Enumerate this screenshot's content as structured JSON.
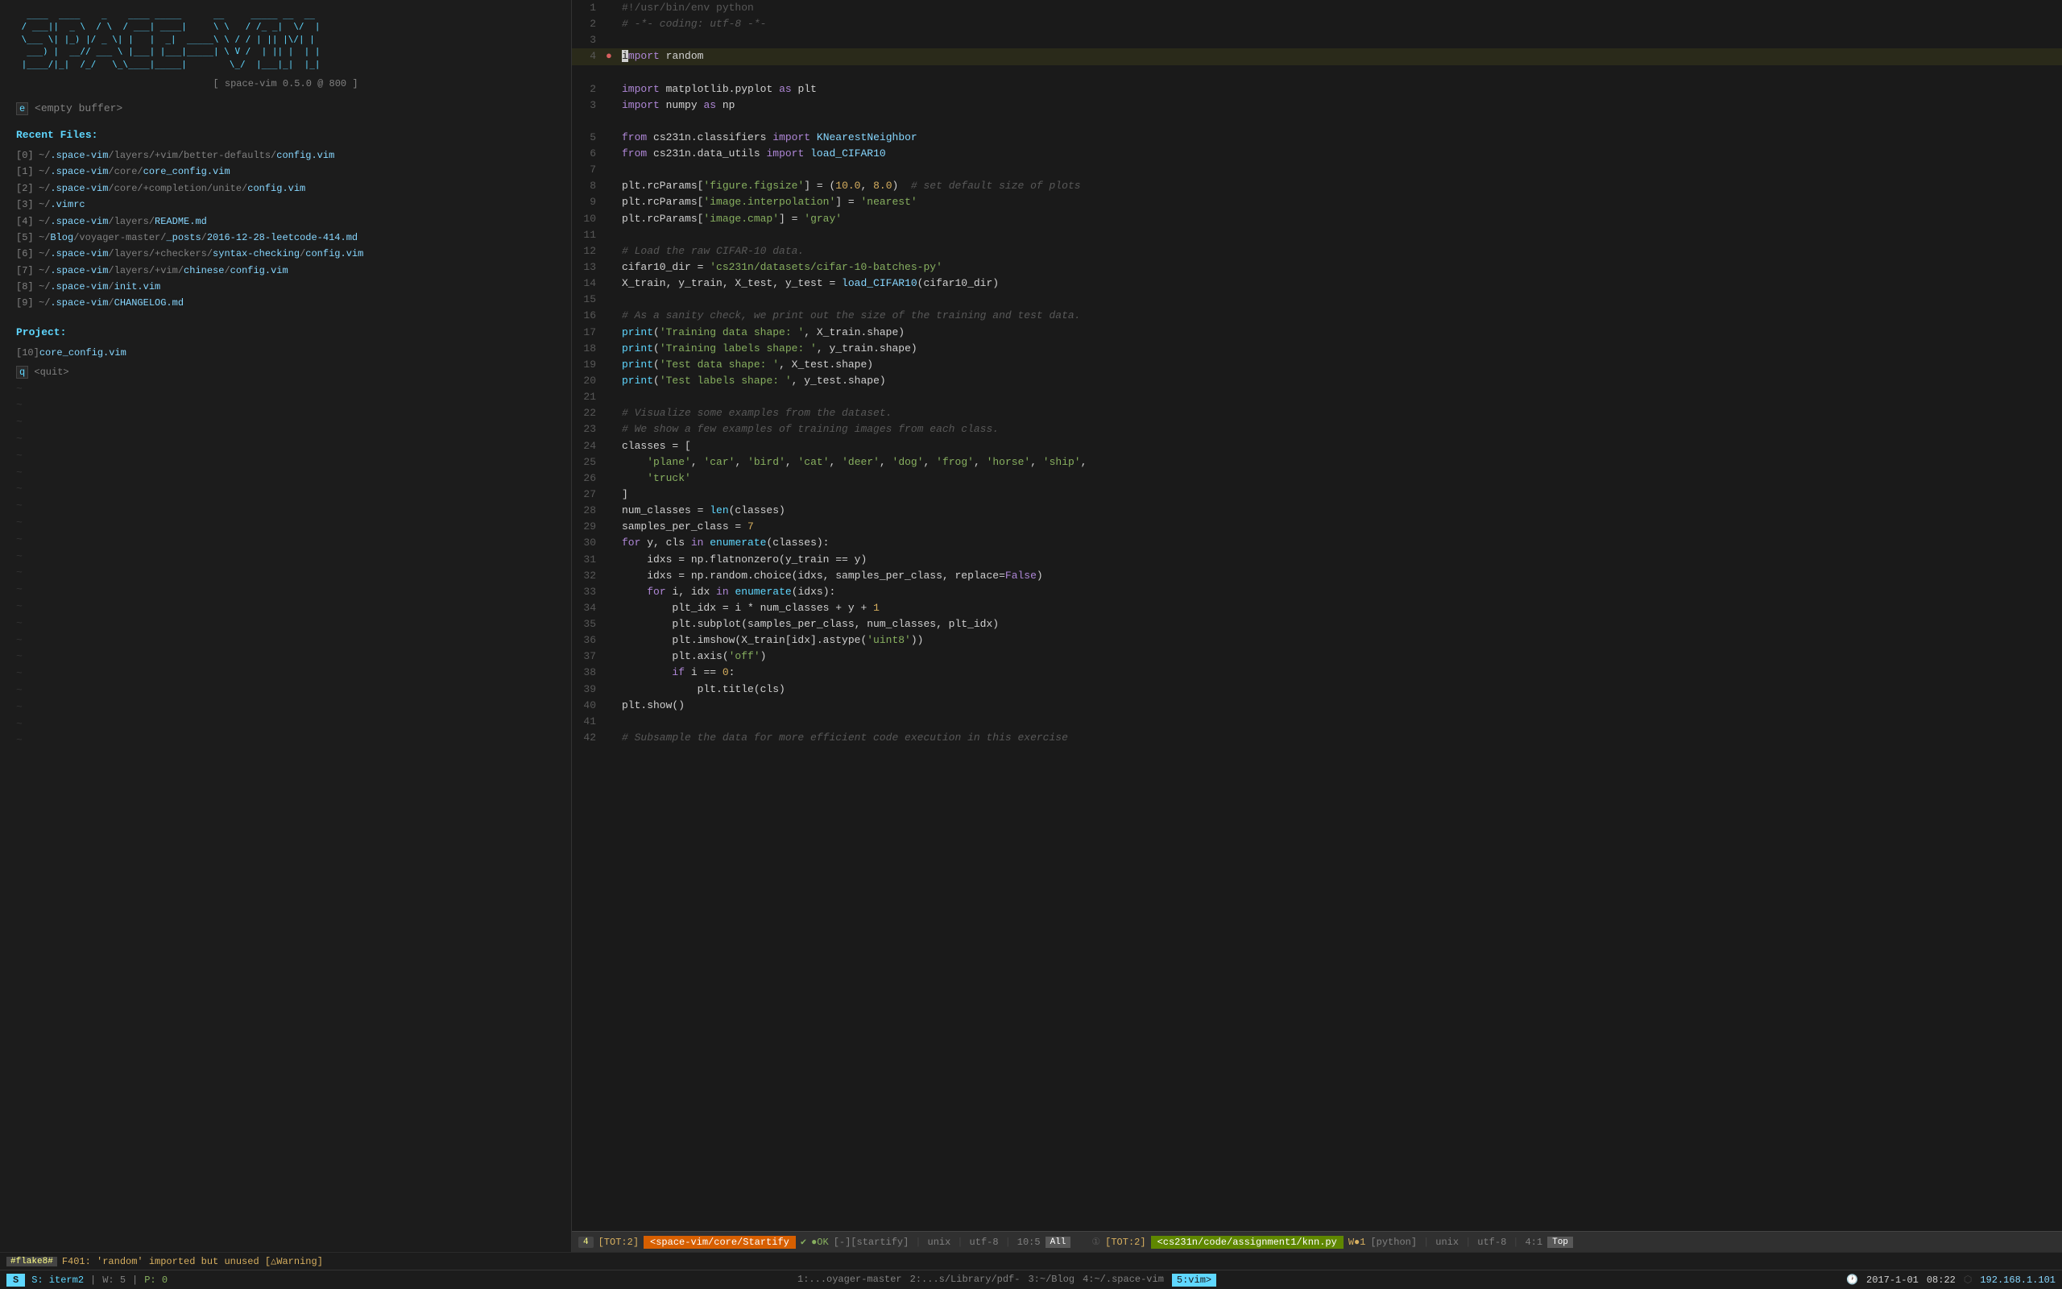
{
  "left": {
    "ascii_logo": "  ____  ____    _    ____ _____      __     _____ __  __ \n / ___||  _ \\  / \\  / ___| ____|     \\ \\   / /_ _|  \\/  |\n \\___ \\| |_) |/ _ \\| |   |  _|  _____\\ \\ / / | || |\\/| |\n  ___) |  __// ___ \\ |___| |___|_____|\\ V /  | || |  | |\n |____/|_|  /_/   \\_\\____|_____|       \\_/  |___|_|  |_|",
    "version_line": "[ space-vim 0.5.0 @ 800 ]",
    "empty_buffer": "[e]  <empty buffer>",
    "recent_files_title": "Recent Files:",
    "files": [
      {
        "index": "[0]",
        "path": "~/.space-vim/layers/+vim/better-defaults/config.vim"
      },
      {
        "index": "[1]",
        "path": "~/.space-vim/core/core_config.vim"
      },
      {
        "index": "[2]",
        "path": "~/.space-vim/core/+completion/unite/config.vim"
      },
      {
        "index": "[3]",
        "path": "~/.vimrc"
      },
      {
        "index": "[4]",
        "path": "~/.space-vim/layers/README.md"
      },
      {
        "index": "[5]",
        "path": "~/Blog/voyager-master/_posts/2016-12-28-leetcode-414.md"
      },
      {
        "index": "[6]",
        "path": "~/.space-vim/layers/+checkers/syntax-checking/config.vim"
      },
      {
        "index": "[7]",
        "path": "~/.space-vim/layers/+vim/chinese/config.vim"
      },
      {
        "index": "[8]",
        "path": "~/.space-vim/init.vim"
      },
      {
        "index": "[9]",
        "path": "~/.space-vim/CHANGELOG.md"
      }
    ],
    "project_title": "Project:",
    "project_file": "[10]  core_config.vim",
    "quit_line": "[q]  <quit>"
  },
  "code": {
    "lines": [
      {
        "num": "1",
        "dot": "",
        "content": "#!/usr/bin/env python",
        "type": "shebang"
      },
      {
        "num": "2",
        "dot": "",
        "content": "# -*- coding: utf-8 -*-",
        "type": "comment"
      },
      {
        "num": "3",
        "dot": "",
        "content": "",
        "type": "empty"
      },
      {
        "num": "4",
        "dot": "●",
        "content": "import random",
        "type": "code",
        "active": true
      },
      {
        "num": "",
        "dot": "",
        "content": "",
        "type": "empty"
      },
      {
        "num": "2",
        "dot": "",
        "content": "import matplotlib.pyplot as plt",
        "type": "code"
      },
      {
        "num": "3",
        "dot": "",
        "content": "import numpy as np",
        "type": "code"
      },
      {
        "num": "",
        "dot": "",
        "content": "",
        "type": "empty"
      },
      {
        "num": "5",
        "dot": "",
        "content": "from cs231n.classifiers import KNearestNeighbor",
        "type": "code"
      },
      {
        "num": "6",
        "dot": "",
        "content": "from cs231n.data_utils import load_CIFAR10",
        "type": "code"
      },
      {
        "num": "7",
        "dot": "",
        "content": "",
        "type": "empty"
      },
      {
        "num": "8",
        "dot": "",
        "content": "plt.rcParams['figure.figsize'] = (10.0, 8.0)  # set default size of plots",
        "type": "code"
      },
      {
        "num": "9",
        "dot": "",
        "content": "plt.rcParams['image.interpolation'] = 'nearest'",
        "type": "code"
      },
      {
        "num": "10",
        "dot": "",
        "content": "plt.rcParams['image.cmap'] = 'gray'",
        "type": "code"
      },
      {
        "num": "11",
        "dot": "",
        "content": "",
        "type": "empty"
      },
      {
        "num": "12",
        "dot": "",
        "content": "# Load the raw CIFAR-10 data.",
        "type": "comment"
      },
      {
        "num": "13",
        "dot": "",
        "content": "cifar10_dir = 'cs231n/datasets/cifar-10-batches-py'",
        "type": "code"
      },
      {
        "num": "14",
        "dot": "",
        "content": "X_train, y_train, X_test, y_test = load_CIFAR10(cifar10_dir)",
        "type": "code"
      },
      {
        "num": "15",
        "dot": "",
        "content": "",
        "type": "empty"
      },
      {
        "num": "16",
        "dot": "",
        "content": "# As a sanity check, we print out the size of the training and test data.",
        "type": "comment"
      },
      {
        "num": "17",
        "dot": "",
        "content": "print('Training data shape: ', X_train.shape)",
        "type": "code"
      },
      {
        "num": "18",
        "dot": "",
        "content": "print('Training labels shape: ', y_train.shape)",
        "type": "code"
      },
      {
        "num": "19",
        "dot": "",
        "content": "print('Test data shape: ', X_test.shape)",
        "type": "code"
      },
      {
        "num": "20",
        "dot": "",
        "content": "print('Test labels shape: ', y_test.shape)",
        "type": "code"
      },
      {
        "num": "21",
        "dot": "",
        "content": "",
        "type": "empty"
      },
      {
        "num": "22",
        "dot": "",
        "content": "# Visualize some examples from the dataset.",
        "type": "comment"
      },
      {
        "num": "23",
        "dot": "",
        "content": "# We show a few examples of training images from each class.",
        "type": "comment"
      },
      {
        "num": "24",
        "dot": "",
        "content": "classes = [",
        "type": "code"
      },
      {
        "num": "25",
        "dot": "",
        "content": "    'plane', 'car', 'bird', 'cat', 'deer', 'dog', 'frog', 'horse', 'ship',",
        "type": "code"
      },
      {
        "num": "26",
        "dot": "",
        "content": "    'truck'",
        "type": "code"
      },
      {
        "num": "27",
        "dot": "",
        "content": "]",
        "type": "code"
      },
      {
        "num": "28",
        "dot": "",
        "content": "num_classes = len(classes)",
        "type": "code"
      },
      {
        "num": "29",
        "dot": "",
        "content": "samples_per_class = 7",
        "type": "code"
      },
      {
        "num": "30",
        "dot": "",
        "content": "for y, cls in enumerate(classes):",
        "type": "code"
      },
      {
        "num": "31",
        "dot": "",
        "content": "    idxs = np.flatnonzero(y_train == y)",
        "type": "code"
      },
      {
        "num": "32",
        "dot": "",
        "content": "    idxs = np.random.choice(idxs, samples_per_class, replace=False)",
        "type": "code"
      },
      {
        "num": "33",
        "dot": "",
        "content": "    for i, idx in enumerate(idxs):",
        "type": "code"
      },
      {
        "num": "34",
        "dot": "",
        "content": "        plt_idx = i * num_classes + y + 1",
        "type": "code"
      },
      {
        "num": "35",
        "dot": "",
        "content": "        plt.subplot(samples_per_class, num_classes, plt_idx)",
        "type": "code"
      },
      {
        "num": "36",
        "dot": "",
        "content": "        plt.imshow(X_train[idx].astype('uint8'))",
        "type": "code"
      },
      {
        "num": "37",
        "dot": "",
        "content": "        plt.axis('off')",
        "type": "code"
      },
      {
        "num": "38",
        "dot": "",
        "content": "        if i == 0:",
        "type": "code"
      },
      {
        "num": "39",
        "dot": "",
        "content": "            plt.title(cls)",
        "type": "code"
      },
      {
        "num": "40",
        "dot": "",
        "content": "plt.show()",
        "type": "code"
      },
      {
        "num": "41",
        "dot": "",
        "content": "",
        "type": "empty"
      },
      {
        "num": "42",
        "dot": "",
        "content": "# Subsample the data for more efficient code execution in this exercise",
        "type": "comment"
      }
    ]
  },
  "status_bar_left": {
    "buf_num": "4",
    "tot": "[TOT:2]",
    "file": "<space-vim/core/Startify",
    "check": "✔",
    "ok": "●OK",
    "bracket_open": "[-]",
    "startify": "[startify]",
    "unix": "unix",
    "encoding": "utf-8",
    "pos": "10:5",
    "all": "All"
  },
  "status_bar_right": {
    "buf_num": "①",
    "tot": "[TOT:2]",
    "file": "<cs231n/code/assignment1/knn.py",
    "w_dot": "W●1",
    "python": "[python]",
    "unix": "unix",
    "encoding": "utf-8",
    "pos": "4:1",
    "top": "Top"
  },
  "warning_bar": {
    "num": "#flake8#",
    "text": "F401: 'random' imported but unused [△Warning]"
  },
  "bottom_bar": {
    "mode": "S",
    "label": "S: iterm2",
    "w": "W: 5",
    "p": "P: 0",
    "path1": "1:...oyager-master",
    "path2": "2:...s/Library/pdf-",
    "path3": "3:~/Blog",
    "path4": "4:~/.space-vim",
    "path5": "5:vim>",
    "date": "2017-1-01",
    "time": "08:22",
    "ip": "192.168.1.101"
  }
}
